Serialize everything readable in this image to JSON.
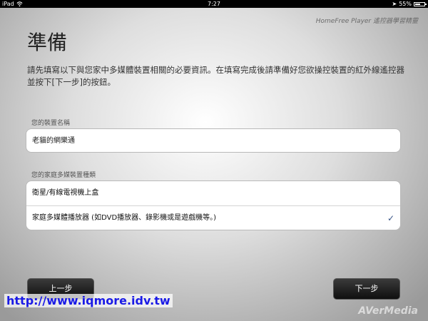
{
  "status_bar": {
    "device": "iPad",
    "time": "7:27",
    "battery": "55%",
    "battery_level": 0.55
  },
  "header": {
    "brand_caption": "HomeFree Player 遙控器學習精靈"
  },
  "page": {
    "title": "準備",
    "description": "請先填寫以下與您家中多媒體裝置相關的必要資訊。在填寫完成後請準備好您欲操控裝置的紅外線遙控器並按下[下一步]的按鈕。"
  },
  "device_name": {
    "label": "您的裝置名稱",
    "value": "老貓的網樂通"
  },
  "device_type": {
    "label": "您的家庭多媒裝置種類",
    "options": [
      {
        "label": "衛星/有線電視機上盒",
        "selected": false
      },
      {
        "label": "家庭多媒體播放器 (如DVD播放器、錄影機或是遊戲機等。)",
        "selected": true
      }
    ],
    "check_glyph": "✓"
  },
  "buttons": {
    "back": "上一步",
    "next": "下一步"
  },
  "watermark": "http://www.iqmore.idv.tw",
  "logo": "AVerMedia"
}
